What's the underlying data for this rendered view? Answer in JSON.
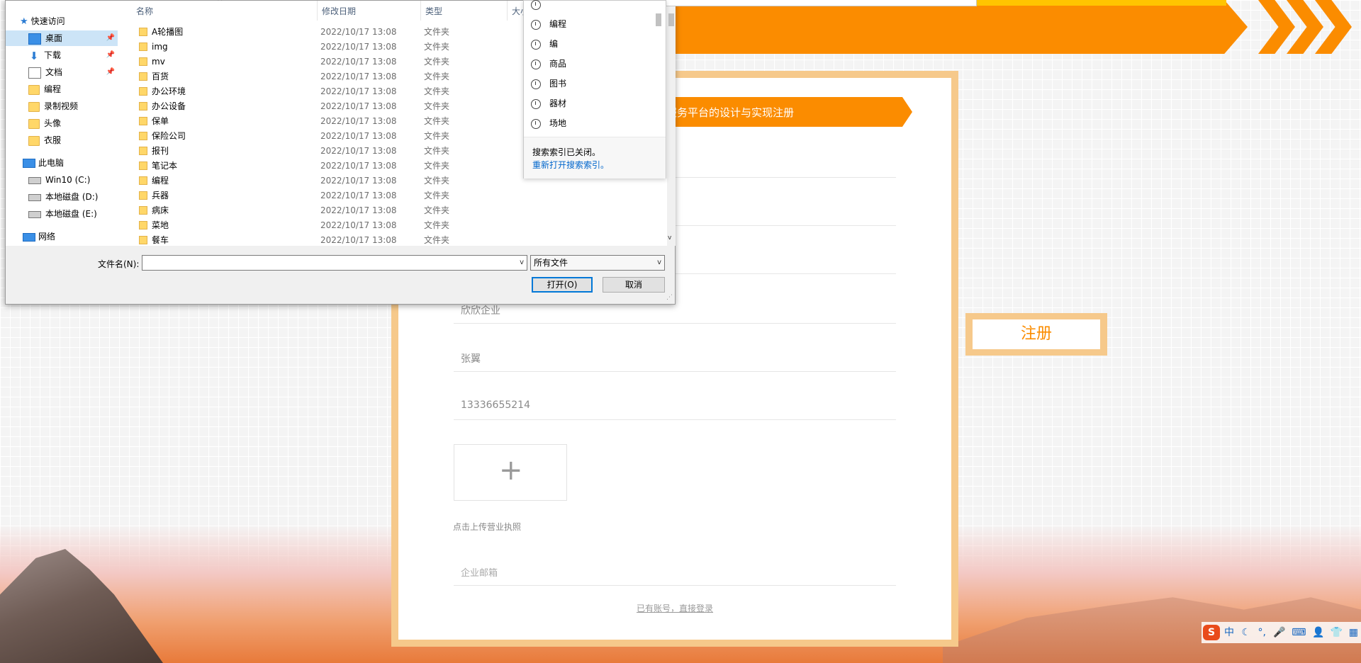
{
  "colors": {
    "accent": "#fb8c00",
    "frame": "#f6c98b",
    "link": "#0066cc"
  },
  "register_page": {
    "ribbon_title": "服务平台的设计与实现注册",
    "fields": [
      {
        "value": "欣欣企业"
      },
      {
        "value": "张翼"
      },
      {
        "value": "13336655214"
      }
    ],
    "upload_icon": "plus-icon",
    "upload_tip": "点击上传营业执照",
    "email_placeholder": "企业邮箱",
    "login_link": "已有账号，直接登录",
    "register_button": "注册"
  },
  "file_dialog": {
    "nav": {
      "quick_access": "快速访问",
      "quick_items": [
        "桌面",
        "下载",
        "文档",
        "编程",
        "录制视频",
        "头像",
        "衣服"
      ],
      "this_pc": "此电脑",
      "drives": [
        "Win10 (C:)",
        "本地磁盘 (D:)",
        "本地磁盘 (E:)"
      ],
      "network": "网络"
    },
    "columns": {
      "name": "名称",
      "date": "修改日期",
      "type": "类型",
      "size": "大小"
    },
    "files": [
      {
        "name": "A轮播图",
        "date": "2022/10/17 13:08",
        "type": "文件夹"
      },
      {
        "name": "img",
        "date": "2022/10/17 13:08",
        "type": "文件夹"
      },
      {
        "name": "mv",
        "date": "2022/10/17 13:08",
        "type": "文件夹"
      },
      {
        "name": "百货",
        "date": "2022/10/17 13:08",
        "type": "文件夹"
      },
      {
        "name": "办公环境",
        "date": "2022/10/17 13:08",
        "type": "文件夹"
      },
      {
        "name": "办公设备",
        "date": "2022/10/17 13:08",
        "type": "文件夹"
      },
      {
        "name": "保单",
        "date": "2022/10/17 13:08",
        "type": "文件夹"
      },
      {
        "name": "保险公司",
        "date": "2022/10/17 13:08",
        "type": "文件夹"
      },
      {
        "name": "报刊",
        "date": "2022/10/17 13:08",
        "type": "文件夹"
      },
      {
        "name": "笔记本",
        "date": "2022/10/17 13:08",
        "type": "文件夹"
      },
      {
        "name": "编程",
        "date": "2022/10/17 13:08",
        "type": "文件夹"
      },
      {
        "name": "兵器",
        "date": "2022/10/17 13:08",
        "type": "文件夹"
      },
      {
        "name": "病床",
        "date": "2022/10/17 13:08",
        "type": "文件夹"
      },
      {
        "name": "菜地",
        "date": "2022/10/17 13:08",
        "type": "文件夹"
      },
      {
        "name": "餐车",
        "date": "2022/10/17 13:08",
        "type": "文件夹"
      }
    ],
    "filename_label": "文件名(N):",
    "filename_value": "",
    "filetype_value": "所有文件",
    "open_button": "打开(O)",
    "cancel_button": "取消",
    "search_history": {
      "items": [
        "编程",
        "编",
        "商品",
        "图书",
        "器材",
        "场地"
      ],
      "status": "搜索索引已关闭。",
      "reopen_link": "重新打开搜索索引。"
    }
  },
  "ime_toolbar": {
    "logo": "S",
    "mode": "中"
  }
}
